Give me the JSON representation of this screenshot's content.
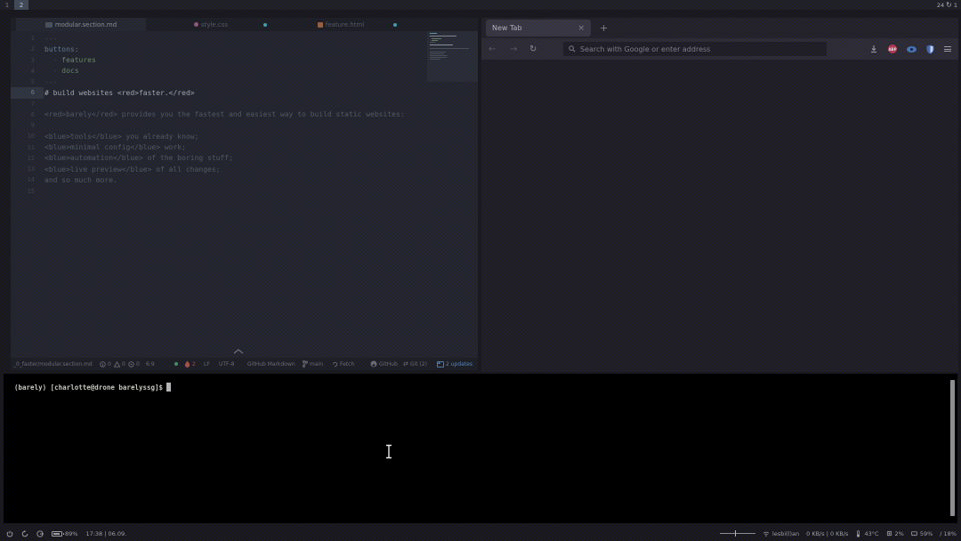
{
  "topbar": {
    "workspaces": [
      {
        "label": "1",
        "active": false
      },
      {
        "label": "2",
        "active": true
      }
    ],
    "updates_count": "24",
    "pending_count": "1"
  },
  "editor": {
    "tabs": [
      {
        "label": "modular.section.md",
        "icon": "markdown",
        "active": true,
        "modified": false
      },
      {
        "label": "style.css",
        "icon": "css",
        "active": false,
        "modified": true
      },
      {
        "label": "feature.html",
        "icon": "html",
        "active": false,
        "modified": true
      }
    ],
    "active_line": 6,
    "lines": [
      {
        "n": 1,
        "segs": [
          {
            "t": "---",
            "c": "punct"
          }
        ]
      },
      {
        "n": 2,
        "segs": [
          {
            "t": "buttons:",
            "c": "key"
          }
        ]
      },
      {
        "n": 3,
        "segs": [
          {
            "t": "  - ",
            "c": "punct"
          },
          {
            "t": "features",
            "c": "string"
          }
        ]
      },
      {
        "n": 4,
        "segs": [
          {
            "t": "  - ",
            "c": "punct"
          },
          {
            "t": "docs",
            "c": "string"
          }
        ]
      },
      {
        "n": 5,
        "segs": [
          {
            "t": "---",
            "c": "punct"
          }
        ]
      },
      {
        "n": 6,
        "segs": [
          {
            "t": "# build websites <red>faster.</red>",
            "c": "heading"
          }
        ]
      },
      {
        "n": 7,
        "segs": []
      },
      {
        "n": 8,
        "segs": [
          {
            "t": "<red>barely</red> provides you the fastest and easiest way to build static websites:",
            "c": "body"
          }
        ]
      },
      {
        "n": 9,
        "segs": []
      },
      {
        "n": 10,
        "segs": [
          {
            "t": "<blue>tools</blue> you already know;",
            "c": "body"
          }
        ]
      },
      {
        "n": 11,
        "segs": [
          {
            "t": "<blue>minimal config</blue> work;",
            "c": "body"
          }
        ]
      },
      {
        "n": 12,
        "segs": [
          {
            "t": "<blue>automation</blue> of the boring stuff;",
            "c": "body"
          }
        ]
      },
      {
        "n": 13,
        "segs": [
          {
            "t": "<blue>live preview</blue> of all changes;",
            "c": "body"
          }
        ]
      },
      {
        "n": 14,
        "segs": [
          {
            "t": "and so much more.",
            "c": "body"
          }
        ]
      },
      {
        "n": 15,
        "segs": []
      }
    ],
    "statusbar": {
      "path": "_0_faster/modular.section.md",
      "info_count": "0",
      "warning_count": "0",
      "error_count": "0",
      "cursor": "6:9",
      "flame_count": "2",
      "line_ending": "LF",
      "encoding": "UTF-8",
      "syntax": "GitHub Markdown",
      "branch": "main",
      "fetch_label": "Fetch",
      "github_label": "GitHub",
      "git_label": "Git (2)",
      "updates_label": "2 updates"
    }
  },
  "browser": {
    "tab_title": "New Tab",
    "urlbar_placeholder": "Search with Google or enter address"
  },
  "terminal": {
    "prompt": "(barely) [charlotte@drone barelyssg]$"
  },
  "bottombar": {
    "battery": "89%",
    "clock": "17:38 | 06.09.",
    "network": "lesbi(l)an",
    "traffic": "0 KB/s | 0 KB/s",
    "temperature": "43°C",
    "cpu": "2%",
    "ram": "59%",
    "disk": "/ 18%"
  }
}
